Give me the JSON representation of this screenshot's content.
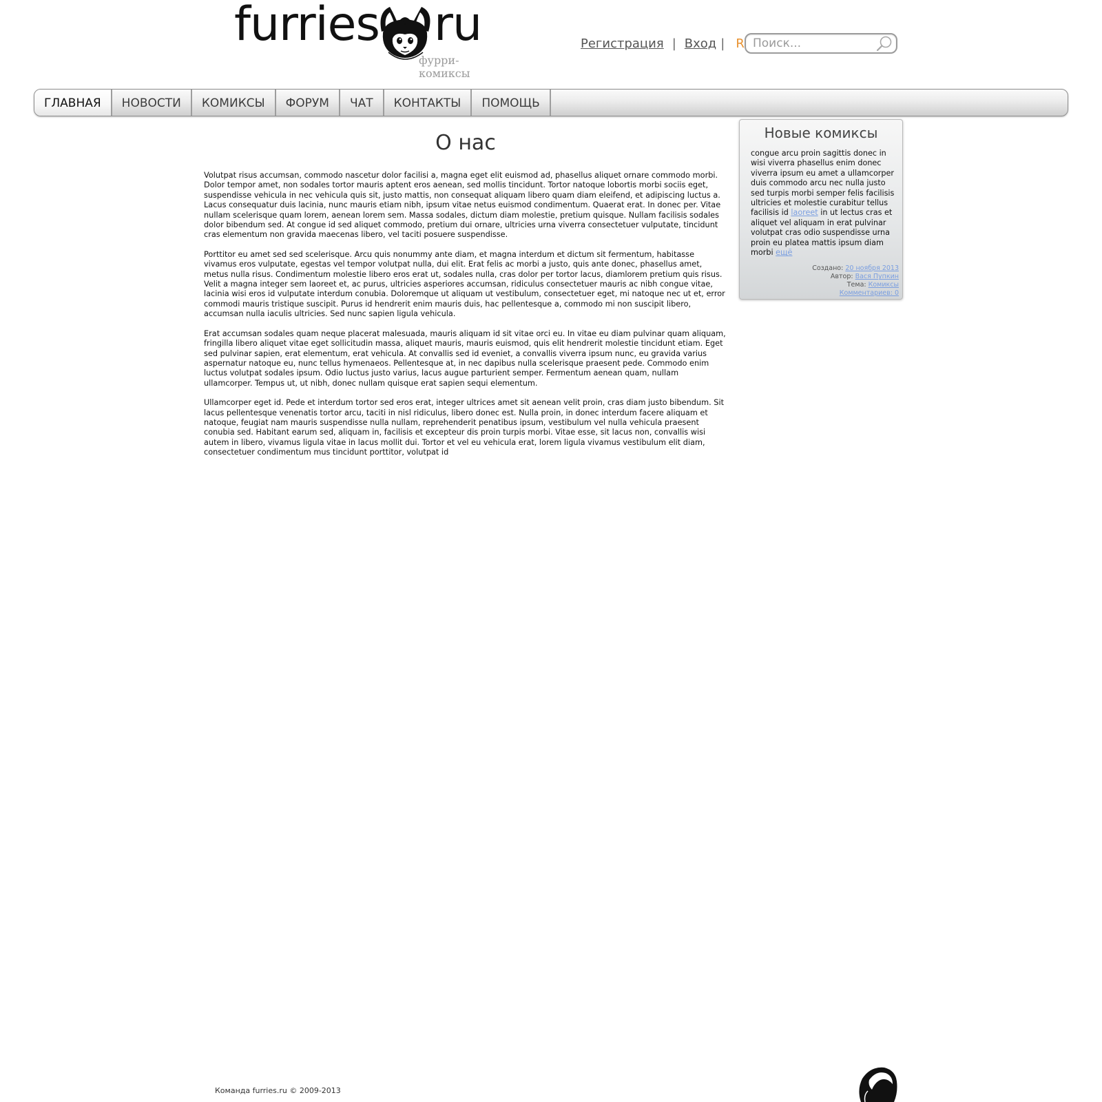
{
  "logo": {
    "word_left": "furries",
    "word_right": "ru",
    "tagline": "фурри-комиксы",
    "mascot_icon": "fox-head-icon"
  },
  "top_links": {
    "register": "Регистрация",
    "separator": "|",
    "login": "Вход",
    "rss": "RSS"
  },
  "search": {
    "placeholder": "Поиск...",
    "icon": "search-icon"
  },
  "nav": {
    "items": [
      {
        "label": "ГЛАВНАЯ"
      },
      {
        "label": "НОВОСТИ"
      },
      {
        "label": "КОМИКСЫ"
      },
      {
        "label": "ФОРУМ"
      },
      {
        "label": "ЧАТ"
      },
      {
        "label": "КОНТАКТЫ"
      },
      {
        "label": "ПОМОЩЬ"
      }
    ]
  },
  "main": {
    "title": "О нас",
    "paragraphs": [
      " Volutpat risus accumsan, commodo nascetur dolor facilisi a, magna eget elit euismod ad, phasellus aliquet ornare commodo morbi. Dolor tempor amet, non sodales tortor mauris aptent eros aenean, sed mollis tincidunt. Tortor natoque lobortis morbi sociis eget, suspendisse vehicula in nec vehicula quis sit, justo mattis, non consequat aliquam libero quam diam eleifend, et adipiscing luctus a. Lacus consequatur duis lacinia, nunc mauris etiam nibh, ipsum vitae netus euismod condimentum. Quaerat erat. In donec per. Vitae nullam scelerisque quam lorem, aenean lorem sem. Massa sodales, dictum diam molestie, pretium quisque. Nullam facilisis sodales dolor bibendum sed. At congue id sed aliquet commodo, pretium dui ornare, ultricies urna viverra consectetuer vulputate, tincidunt cras elementum non gravida maecenas libero, vel taciti posuere suspendisse.",
      "Porttitor eu amet sed sed scelerisque. Arcu quis nonummy ante diam, et magna interdum et dictum sit fermentum, habitasse vivamus eros vulputate, egestas vel tempor volutpat nulla, dui elit. Erat felis ac morbi a justo, quis ante donec, phasellus amet, metus nulla risus. Condimentum molestie libero eros erat ut, sodales nulla, cras dolor per tortor lacus, diamlorem pretium quis risus. Velit a magna integer sem laoreet et, ac purus, ultricies asperiores accumsan, ridiculus consectetuer mauris ac nibh congue vitae, lacinia wisi eros id vulputate interdum conubia. Doloremque ut aliquam ut vestibulum, consectetuer eget, mi natoque nec ut et, error commodi mauris tristique suscipit. Purus id hendrerit enim mauris duis, hac pellentesque a, commodo mi non suscipit libero, accumsan nulla iaculis ultricies. Sed nunc sapien ligula vehicula.",
      "Erat accumsan sodales quam neque placerat malesuada, mauris aliquam id sit vitae orci eu. In vitae eu diam pulvinar quam aliquam, fringilla libero aliquet vitae eget sollicitudin massa, aliquet mauris, mauris euismod, quis elit hendrerit molestie tincidunt etiam. Eget sed pulvinar sapien, erat elementum, erat vehicula. At convallis sed id eveniet, a convallis viverra ipsum nunc, eu gravida varius aspernatur natoque eu, nunc tellus hymenaeos. Pellentesque at, in nec dapibus nulla scelerisque praesent pede. Commodo enim luctus volutpat sodales ipsum. Odio luctus justo varius, lacus augue parturient semper. Fermentum aenean quam, nullam ullamcorper. Tempus ut, ut nibh, donec nullam quisque erat sapien sequi elementum.",
      "Ullamcorper eget id. Pede et interdum tortor sed eros erat, integer ultrices amet sit aenean velit proin, cras diam justo bibendum. Sit lacus pellentesque venenatis tortor arcu, taciti in nisl ridiculus, libero donec est. Nulla proin, in donec interdum facere aliquam et natoque, feugiat nam mauris suspendisse nulla nullam, reprehenderit penatibus ipsum, vestibulum vel nulla vehicula praesent conubia sed. Habitant earum sed, aliquam in, facilisis et excepteur dis proin turpis morbi. Vitae esse, sit lacus non, convallis wisi autem in libero, vivamus ligula vitae in lacus mollit dui. Tortor et vel eu vehicula erat, lorem ligula vivamus vestibulum elit diam, consectetuer condimentum mus tincidunt porttitor, volutpat id"
    ]
  },
  "sidebar": {
    "title": "Новые комиксы",
    "text_before_link": "congue arcu proin sagittis donec in wisi viverra phasellus enim donec viverra ipsum eu amet a ullamcorper duis commodo arcu nec nulla justo sed turpis morbi semper felis facilisis ultricies et molestie curabitur tellus facilisis id ",
    "inline_link": "laoreet",
    "text_after_link": " in ut lectus cras et aliquet vel aliquam in erat pulvinar volutpat cras odio suspendisse urna proin eu platea mattis ipsum diam morbi ",
    "more_link": "ещё",
    "meta": {
      "created_label": "Создано:",
      "created_value": "20 ноября 2013",
      "author_label": "Автор:",
      "author_value": "Вася Пупкин",
      "topic_label": "Тема:",
      "topic_value": "Комиксы",
      "comments_link": "Комментариев: 0"
    }
  },
  "footer": {
    "copyright": "Команда furries.ru © 2009-2013",
    "mascot_icon": "fox-tail-icon"
  },
  "colors": {
    "link_blue": "#7a9ee0",
    "rss_orange": "#e8912e",
    "nav_border": "#8e8e8e"
  }
}
